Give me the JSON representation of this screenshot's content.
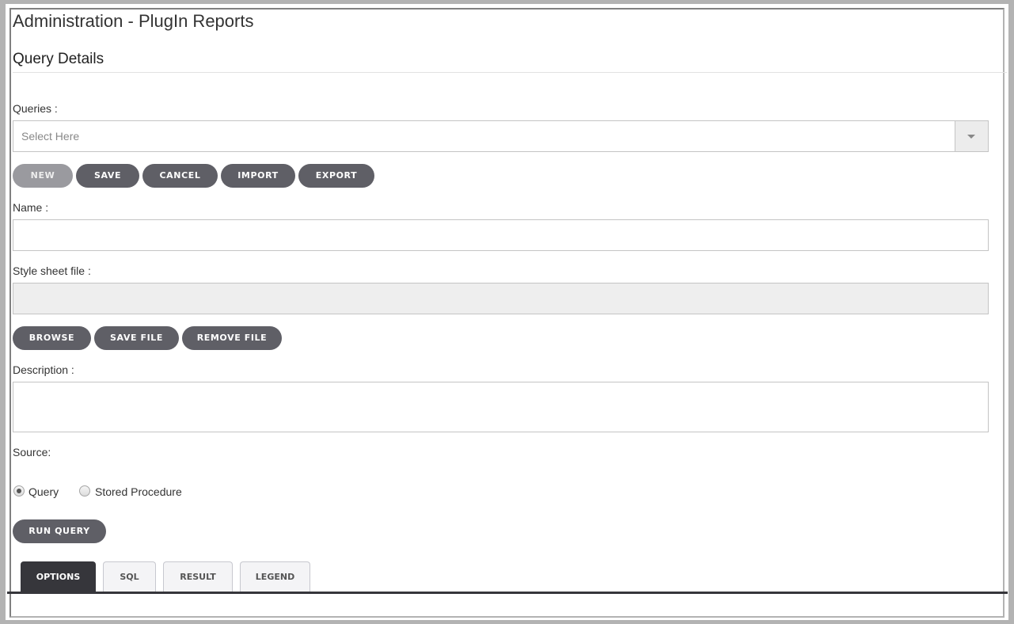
{
  "header": {
    "title": "Administration - PlugIn Reports",
    "section_title": "Query Details"
  },
  "queries": {
    "label": "Queries :",
    "placeholder": "Select Here",
    "dropdown_icon": "caret-down-icon"
  },
  "query_actions": [
    {
      "label": "NEW",
      "disabled": true
    },
    {
      "label": "SAVE",
      "disabled": false
    },
    {
      "label": "CANCEL",
      "disabled": false
    },
    {
      "label": "IMPORT",
      "disabled": false
    },
    {
      "label": "EXPORT",
      "disabled": false
    }
  ],
  "name": {
    "label": "Name :",
    "value": ""
  },
  "style_sheet": {
    "label": "Style sheet file :",
    "value": ""
  },
  "file_actions": [
    {
      "label": "BROWSE"
    },
    {
      "label": "SAVE FILE"
    },
    {
      "label": "REMOVE FILE"
    }
  ],
  "description": {
    "label": "Description :",
    "value": ""
  },
  "source": {
    "label": "Source:",
    "options": [
      {
        "label": "Query",
        "selected": true
      },
      {
        "label": "Stored Procedure",
        "selected": false
      }
    ]
  },
  "run_query": {
    "label": "RUN QUERY"
  },
  "tabs": [
    {
      "label": "OPTIONS",
      "active": true
    },
    {
      "label": "SQL",
      "active": false
    },
    {
      "label": "RESULT",
      "active": false
    },
    {
      "label": "LEGEND",
      "active": false
    }
  ],
  "colors": {
    "button": "#5f5f66",
    "button_disabled": "#9a9a9f",
    "tab_active": "#36363b"
  }
}
